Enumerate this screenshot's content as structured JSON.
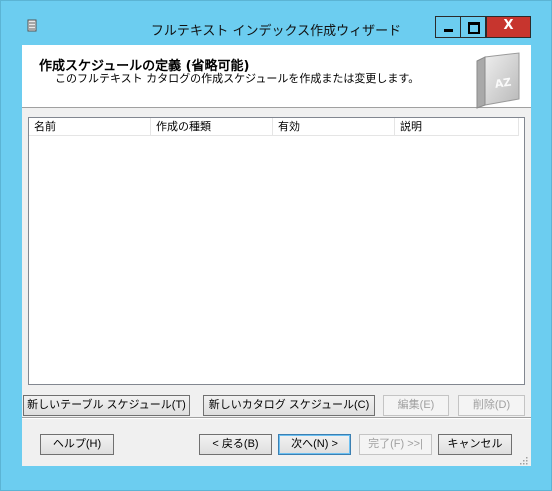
{
  "window": {
    "title": "フルテキスト インデックス作成ウィザード",
    "minimize_glyph": "▁",
    "maximize_glyph": "□",
    "close_glyph": "X"
  },
  "header": {
    "title": "作成スケジュールの定義 (省略可能)",
    "subtitle": "このフルテキスト カタログの作成スケジュールを作成または変更します。",
    "book_label": "AZ"
  },
  "list": {
    "columns": [
      "名前",
      "作成の種類",
      "有効",
      "説明"
    ],
    "rows": []
  },
  "schedule_buttons": {
    "new_table": "新しいテーブル スケジュール(T)",
    "new_catalog": "新しいカタログ スケジュール(C)",
    "edit": "編集(E)",
    "delete": "削除(D)"
  },
  "nav_buttons": {
    "help": "ヘルプ(H)",
    "back": "< 戻る(B)",
    "next": "次へ(N) >",
    "finish": "完了(F) >>|",
    "cancel": "キャンセル"
  },
  "colors": {
    "titlebar": "#6ccdf0",
    "close": "#c7352e",
    "client": "#f0f0f0"
  }
}
